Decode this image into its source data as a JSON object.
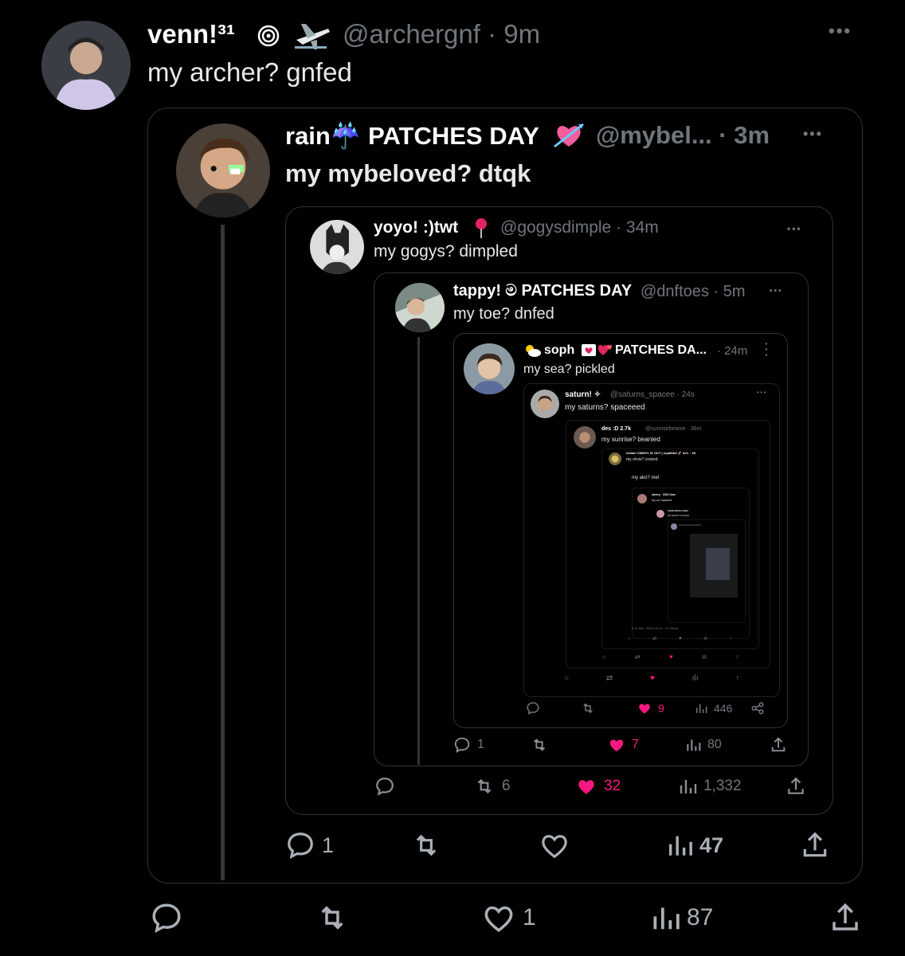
{
  "tweet1": {
    "name": "venn!³¹",
    "handle": "@archergnf",
    "time": "· 9m",
    "text": "my archer? gnfed",
    "icons": [
      "cyclone-icon",
      "airplane-icon"
    ],
    "actions": {
      "reply": "",
      "retweet": "",
      "like": "1",
      "views": "87"
    }
  },
  "tweet2": {
    "name": "rain☔ PATCHES DAY",
    "handle": "@mybel...",
    "time": "· 3m",
    "text": "my mybeloved? dtqk",
    "icons": [
      "cupid-heart-icon"
    ],
    "actions": {
      "reply": "1",
      "retweet": "",
      "like": "",
      "views": "47"
    }
  },
  "tweet3": {
    "name": "yoyo! :)twt",
    "handle": "@gogysdimple",
    "time": "· 34m",
    "text": "my gogys? dimpled",
    "icons": [
      "pin-icon"
    ],
    "actions": {
      "reply": "",
      "retweet": "6",
      "like": "32",
      "views": "1,332"
    }
  },
  "tweet4": {
    "name": "tappy! ම PATCHES DAY",
    "handle": "@dnftoes",
    "time": "· 5m",
    "text": "my toe? dnfed",
    "actions": {
      "reply": "1",
      "retweet": "",
      "like": "7",
      "views": "80"
    }
  },
  "tweet5": {
    "name": "soph",
    "name2": "PATCHES DA...",
    "time": "· 24m",
    "text": "my sea? pickled",
    "icons": [
      "sun-cloud-icon",
      "love-letter-icon",
      "hearts-icon"
    ],
    "actions": {
      "reply": "",
      "retweet": "",
      "like": "9",
      "views": "446"
    }
  },
  "tweet6": {
    "name": "saturn! ✧",
    "handle": "@saturns_spacee",
    "time": "· 24s",
    "text": "my saturns? spaceeed"
  },
  "tweet7": {
    "name": "des :D 2.7k",
    "handle": "@sunrisebeanie · 36m",
    "text": "my sunrise? beanied"
  },
  "tweet8": {
    "name": "vivian! CMWYL IS OUT | royalfdnf 🚀 dv1. · 4h",
    "text": "my vhvis? cocked."
  },
  "tweet9": {
    "text": "my ako? met"
  },
  "tweet10": {
    "name": "sherry · 2022 time",
    "text": "my oc? squared"
  },
  "tweet11": {
    "name": "Fanfic/fiction Stan",
    "text": "My Fanfic? Finished"
  },
  "deep_timestamp": "5:12 AM · 2023-03-11 · 12 Views",
  "colors": {
    "bg": "#000000",
    "grey": "#71767b",
    "like": "#f91880",
    "border": "#2f3336"
  }
}
